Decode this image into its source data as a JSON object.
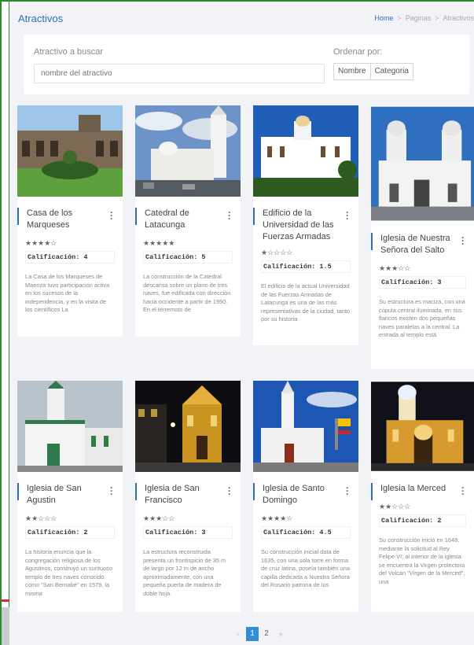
{
  "page": {
    "title": "Atractivos"
  },
  "breadcrumb": {
    "home": "Home",
    "sep": ">",
    "pages": "Paginas",
    "current": "Atractivos"
  },
  "filters": {
    "search_label": "Atractivo a buscar",
    "search_placeholder": "nombre del atractivo",
    "sort_label": "Ordenar por:",
    "sort_name": "Nombre",
    "sort_category": "Categoria"
  },
  "rating_prefix": "Calificación:",
  "attractions": [
    {
      "title": "Casa de los Marqueses",
      "stars": "★★★★☆",
      "rating": "4",
      "description": "La Casa de los Marqueses de Maenza tuvo participación activa en los sucesos de la independencia, y en la visita de los científicos La"
    },
    {
      "title": "Catedral de Latacunga",
      "stars": "★★★★★",
      "rating": "5",
      "description": "La construcción de la Catedral descansa sobre un plano de tres naves, fue edificada con dirección hacia occidente a partir de 1950. En el terremoto de"
    },
    {
      "title": "Edificio de la Universidad de las Fuerzas Armadas",
      "stars": "★☆☆☆☆",
      "rating": "1.5",
      "description": "El edificio de la actual Universidad de las Fuerzas Armadas de Latacunga es una de las más representativas de la ciudad, tanto por su historia"
    },
    {
      "title": "Iglesia de Nuestra Señora del Salto",
      "stars": "★★★☆☆",
      "rating": "3",
      "description": "Su estructura es maciza, con una cúpula central iluminada, en sus flancos existen dos pequeñas naves paralelas a la central. La entrada al templo está"
    },
    {
      "title": "Iglesia de San Agustin",
      "stars": "★★☆☆☆",
      "rating": "2",
      "description": "La historia enuncia que la congregación religiosa de los Agustinos, construyó un suntuoso templo de tres naves conocido como \"San Bernabé\" en 1579, la misma"
    },
    {
      "title": "Iglesia de San Francisco",
      "stars": "★★★☆☆",
      "rating": "3",
      "description": "La estructura reconstruida presenta un frontispicio de 35 m de largo por 12 m de ancho aproximadamente, con una pequeña puerta de madera de doble hoja."
    },
    {
      "title": "Iglesia de Santo Domingo",
      "stars": "★★★★☆",
      "rating": "4.5",
      "description": "Su construcción inicial data de 1635, con una sola torre en forma de cruz latina, poseía también una capilla dedicada a Nuestra Señora del Rosario patrona de los"
    },
    {
      "title": "Iglesia la Merced",
      "stars": "★★☆☆☆",
      "rating": "2",
      "description": "Su construcción inició en 1648, mediante la solicitud al Rey Felipe VI; al interior de la iglesia se encuentra la Virgen protectora del Volcán \"Virgen de la Merced\", una"
    }
  ],
  "pagination": {
    "prev": "‹",
    "page1": "1",
    "page2": "2",
    "next": "»"
  },
  "colors": {
    "accent": "#2f6fb5",
    "active_page": "#2f8fd6",
    "frame": "#2c8a2c"
  }
}
